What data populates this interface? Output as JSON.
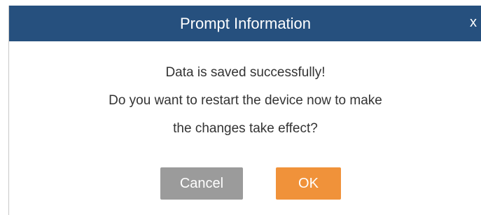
{
  "dialog": {
    "title": "Prompt Information",
    "close_label": "x",
    "message_lines": [
      "Data is saved successfully!",
      "Do you want to restart the device now to make",
      "the changes take effect?"
    ],
    "buttons": {
      "cancel_label": "Cancel",
      "ok_label": "OK"
    },
    "colors": {
      "titlebar": "#26507e",
      "cancel_button": "#9b9b9b",
      "ok_button": "#f0923a"
    }
  }
}
